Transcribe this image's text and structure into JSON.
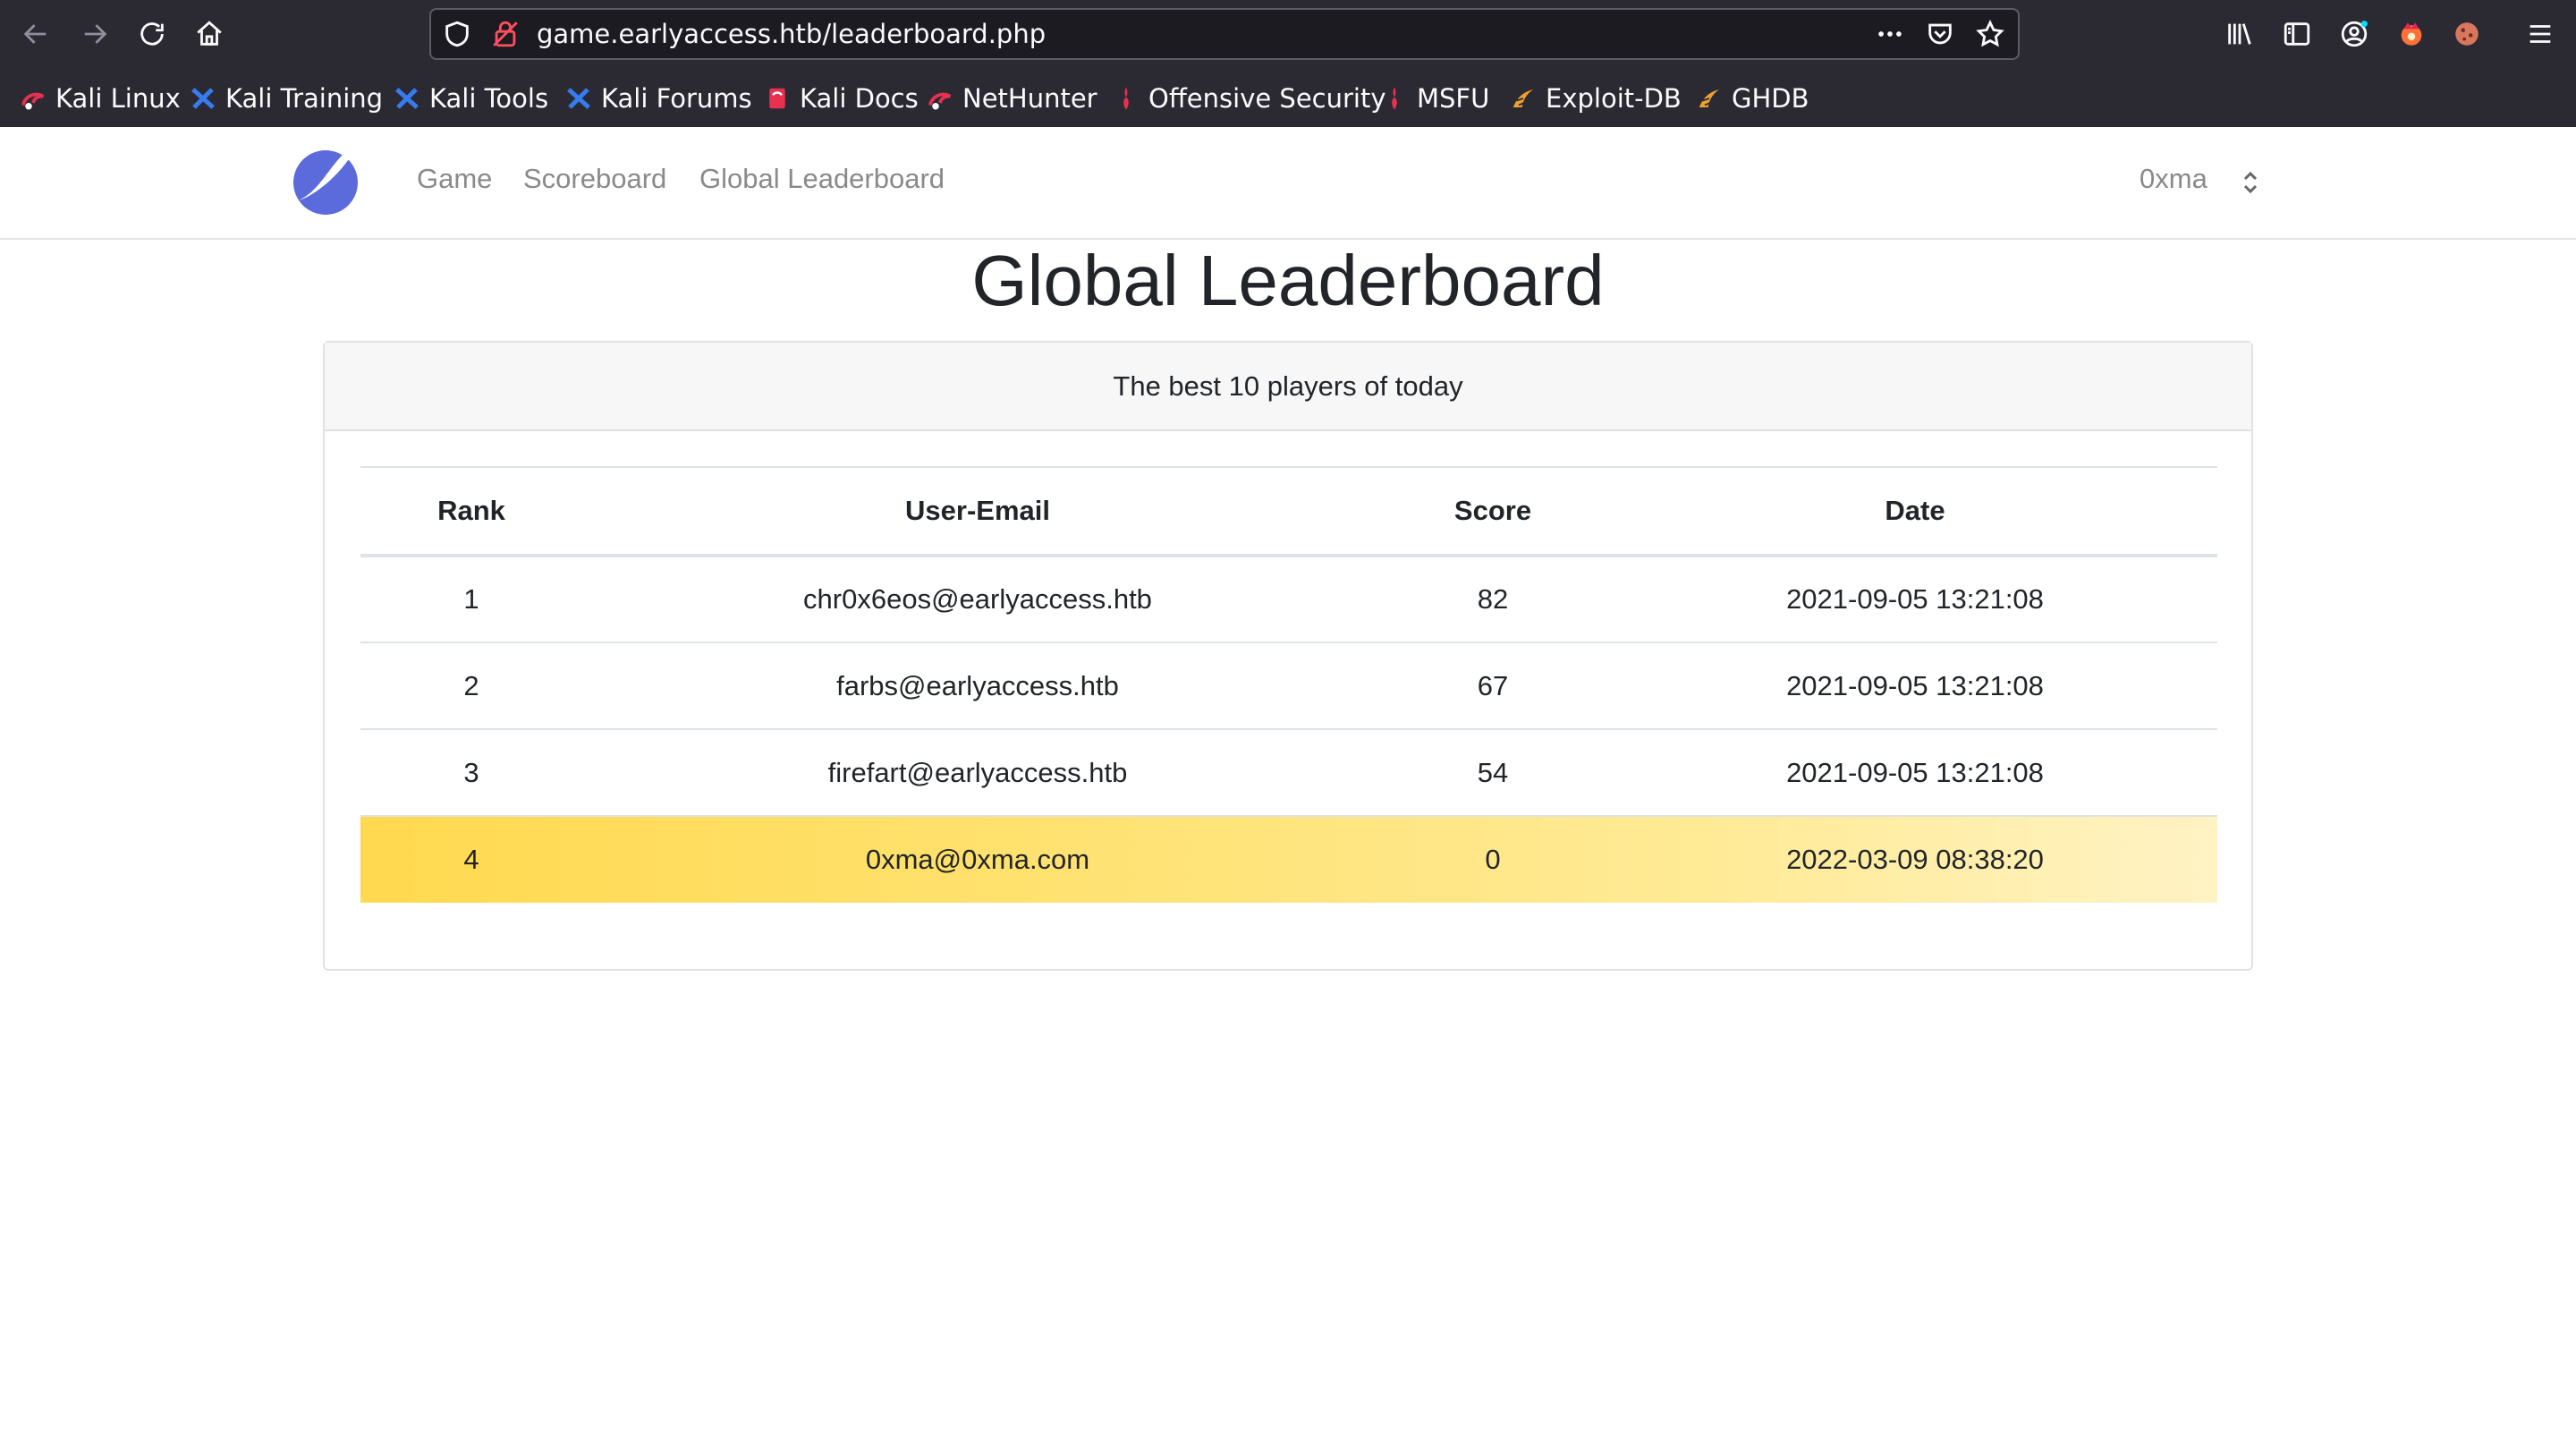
{
  "browser": {
    "url": "game.earlyaccess.htb/leaderboard.php",
    "bookmarks": [
      {
        "label": "Kali Linux",
        "icon": "kali-dragon-icon"
      },
      {
        "label": "Kali Training",
        "icon": "kali-training-icon"
      },
      {
        "label": "Kali Tools",
        "icon": "kali-tools-icon"
      },
      {
        "label": "Kali Forums",
        "icon": "kali-forums-icon"
      },
      {
        "label": "Kali Docs",
        "icon": "kali-docs-icon"
      },
      {
        "label": "NetHunter",
        "icon": "nethunter-icon"
      },
      {
        "label": "Offensive Security",
        "icon": "offsec-icon"
      },
      {
        "label": "MSFU",
        "icon": "msfu-icon"
      },
      {
        "label": "Exploit-DB",
        "icon": "exploit-db-icon"
      },
      {
        "label": "GHDB",
        "icon": "ghdb-icon"
      }
    ]
  },
  "nav": {
    "links": [
      "Game",
      "Scoreboard",
      "Global Leaderboard"
    ],
    "user": "0xma"
  },
  "page": {
    "title": "Global Leaderboard",
    "subtitle": "The best 10 players of today"
  },
  "table": {
    "headers": [
      "Rank",
      "User-Email",
      "Score",
      "Date"
    ],
    "rows": [
      {
        "rank": "1",
        "email": "chr0x6eos@earlyaccess.htb",
        "score": "82",
        "date": "2021-09-05 13:21:08"
      },
      {
        "rank": "2",
        "email": "farbs@earlyaccess.htb",
        "score": "67",
        "date": "2021-09-05 13:21:08"
      },
      {
        "rank": "3",
        "email": "firefart@earlyaccess.htb",
        "score": "54",
        "date": "2021-09-05 13:21:08"
      },
      {
        "rank": "4",
        "email": "0xma@0xma.com",
        "score": "0",
        "date": "2022-03-09 08:38:20"
      }
    ],
    "highlight_color": "#ffd94f"
  },
  "colors": {
    "chrome_bg": "#2b2a33",
    "brand": "#5b6bdc"
  }
}
